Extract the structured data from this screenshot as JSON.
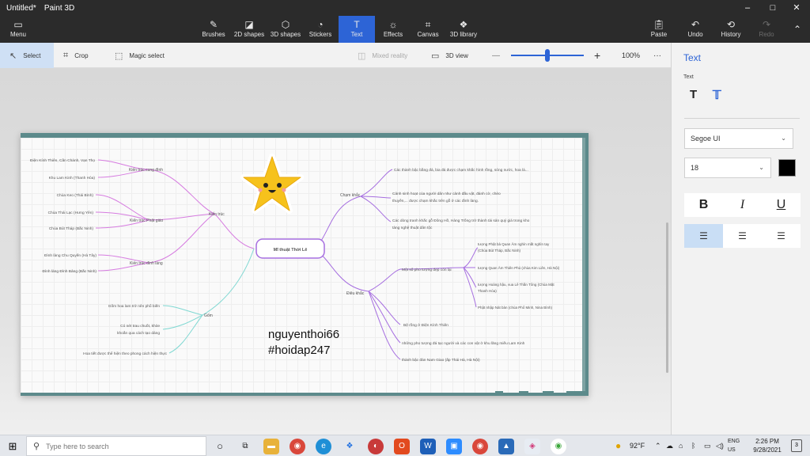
{
  "title": {
    "doc": "Untitled*",
    "app": "Paint 3D"
  },
  "window_controls": {
    "minimize": "–",
    "maximize": "□",
    "close": "✕"
  },
  "ribbon": {
    "menu": "Menu",
    "brushes": "Brushes",
    "shapes2d": "2D shapes",
    "shapes3d": "3D shapes",
    "stickers": "Stickers",
    "text": "Text",
    "effects": "Effects",
    "canvas": "Canvas",
    "library3d": "3D library",
    "paste": "Paste",
    "undo": "Undo",
    "history": "History",
    "redo": "Redo"
  },
  "toolbar": {
    "select": "Select",
    "crop": "Crop",
    "magic_select": "Magic select",
    "mixed_reality": "Mixed reality",
    "view3d": "3D view",
    "zoom_minus": "—",
    "zoom_plus": "+",
    "zoom_level": "100%",
    "more": "···",
    "zoom_fraction": 0.5
  },
  "panel": {
    "title": "Text",
    "type_label": "Text",
    "font": "Segoe UI",
    "size": "18",
    "color": "#000000",
    "bold": "B",
    "italic": "I",
    "underline": "U"
  },
  "mindmap": {
    "center": "Mĩ thuật Thời Lê",
    "left": {
      "kien_truc": "Kiến trúc",
      "kt_cung_dinh": "Kiến trúc cung đình",
      "kt_phat_giao": "Kiến trúc Phật giáo",
      "kt_dinh_lang": "Kiến trúc đình làng",
      "l1": "Điện Kính Thiên, Cần Chánh, Vạn Thọ",
      "l2": "Khu Lam Kinh (Thanh Hóa)",
      "l3": "Chùa Keo (Thái Bình)",
      "l4": "Chùa Thái Lạc (Hưng Yên)",
      "l5": "Chùa Bút Tháp (Bắc Ninh)",
      "l6": "Đình làng Chu Quyến (Hà Tây)",
      "l7": "Đình làng Đình Bảng (Bắc Ninh)",
      "gom": "Gốm",
      "g1": "Gốm hoa lam trở nên phổ biến",
      "g2a": "Có nét trau chuốt, khỏe",
      "g2b": "khoắn qua cách tạo dáng",
      "g3": "Hoa tiết được thể hiện theo phong cách hiện thực"
    },
    "right": {
      "cham_khac": "Chạm khắc",
      "c1": "Các thành bậc bằng đá, bia đá được chạm khắc hình rồng, sóng nước, hoa lá...",
      "c2a": "Cảnh sinh hoạt của người dân như cảnh đấu vật, đánh cờ, chèo",
      "c2b": "thuyền,... được chạm khắc trên gỗ ở các đình làng.",
      "c3a": "Các dòng tranh khắc gỗ Đông Hồ, Hàng Trống trở thành tài sản quý giá trong kho",
      "c3b": "tàng nghệ thuật dân tộc",
      "dieu_khac": "Điêu khắc",
      "d_group": "Một số pho tượng đẹp còn lại",
      "t1a": "tượng Phật bà Quan Âm nghìn mắt nghìn tay",
      "t1b": "(Chùa Bút Tháp, Bắc Ninh)",
      "t2": "tượng Quan Âm Thiên Phủ (chùa Kim Liên, Hà Nội)",
      "t3a": "tượng Hoàng hậu, vua Lê Thần Tông (Chùa Mật",
      "t3b": "Thanh Hóa)",
      "t4": "Phật nhập Nát bàn (chùa Phổ Minh, Nina Bình)",
      "d2": "Bệ rồng ở Điện Kính Thiên",
      "d3": "những pho tượng đá tạc người và các con vật ở khu lăng miếu Lam Kinh",
      "d4": "thành bậc đàn Nam Giao (ấp Thái Hà, Hà Nội)"
    }
  },
  "watermark": {
    "line1": "nguyenthoi66",
    "line2": "#hoidap247"
  },
  "taskbar": {
    "search_placeholder": "Type here to search",
    "weather": "92°F",
    "lang1": "ENG",
    "lang2": "US",
    "time": "2:26 PM",
    "date": "9/28/2021",
    "notif_count": "3"
  }
}
